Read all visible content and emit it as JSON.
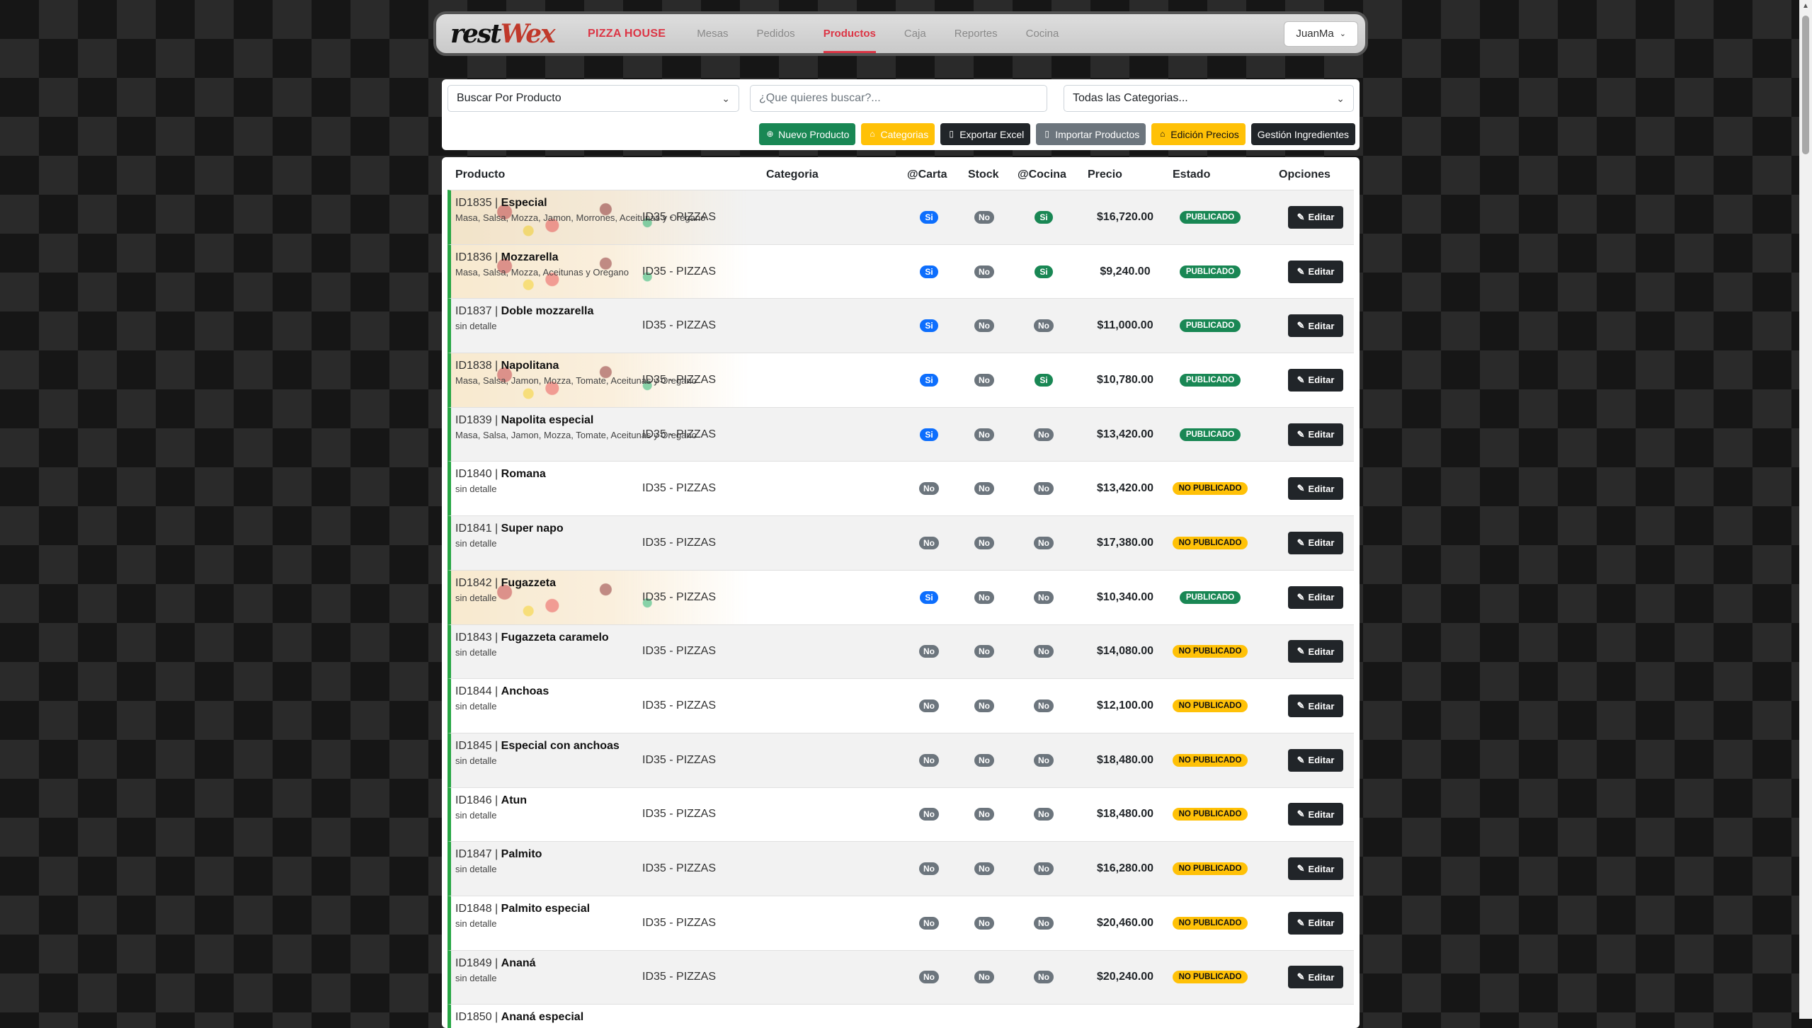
{
  "app": {
    "logo_part1": "rest",
    "logo_part2": "Wex",
    "brand": "PIZZA HOUSE",
    "nav": [
      "Mesas",
      "Pedidos",
      "Productos",
      "Caja",
      "Reportes",
      "Cocina"
    ],
    "active_nav": "Productos",
    "user": "JuanMa"
  },
  "search": {
    "mode_select": "Buscar Por Producto",
    "query_placeholder": "¿Que quieres buscar?...",
    "category_select": "Todas las Categorias..."
  },
  "toolbar": {
    "new_product": "Nuevo Producto",
    "categories": "Categorias",
    "export_excel": "Exportar Excel",
    "import_products": "Importar Productos",
    "edit_prices": "Edición Precios",
    "ingredients": "Gestión Ingredientes"
  },
  "table": {
    "headers": {
      "product": "Producto",
      "category": "Categoria",
      "carta": "@Carta",
      "stock": "Stock",
      "cocina": "@Cocina",
      "price": "Precio",
      "status": "Estado",
      "options": "Opciones"
    },
    "edit_label": "Editar",
    "rows": [
      {
        "id": "ID1835",
        "name": "Especial",
        "desc": "Masa, Salsa, Mozza, Jamon, Morrones, Aceitunas y Oregano",
        "category": "ID35 - PIZZAS",
        "carta": "Si",
        "stock": "No",
        "cocina": "Si",
        "price": "$16,720.00",
        "status": "PUBLICADO",
        "image": true
      },
      {
        "id": "ID1836",
        "name": "Mozzarella",
        "desc": "Masa, Salsa, Mozza, Aceitunas y Oregano",
        "category": "ID35 - PIZZAS",
        "carta": "Si",
        "stock": "No",
        "cocina": "Si",
        "price": "$9,240.00",
        "status": "PUBLICADO",
        "image": true
      },
      {
        "id": "ID1837",
        "name": "Doble mozzarella",
        "desc": "sin detalle",
        "category": "ID35 - PIZZAS",
        "carta": "Si",
        "stock": "No",
        "cocina": "No",
        "price": "$11,000.00",
        "status": "PUBLICADO",
        "image": false
      },
      {
        "id": "ID1838",
        "name": "Napolitana",
        "desc": "Masa, Salsa, Jamon, Mozza, Tomate, Aceitunas y Oregano",
        "category": "ID35 - PIZZAS",
        "carta": "Si",
        "stock": "No",
        "cocina": "Si",
        "price": "$10,780.00",
        "status": "PUBLICADO",
        "image": true
      },
      {
        "id": "ID1839",
        "name": "Napolita especial",
        "desc": "Masa, Salsa, Jamon, Mozza, Tomate, Aceitunas y Oregano",
        "category": "ID35 - PIZZAS",
        "carta": "Si",
        "stock": "No",
        "cocina": "No",
        "price": "$13,420.00",
        "status": "PUBLICADO",
        "image": false
      },
      {
        "id": "ID1840",
        "name": "Romana",
        "desc": "sin detalle",
        "category": "ID35 - PIZZAS",
        "carta": "No",
        "stock": "No",
        "cocina": "No",
        "price": "$13,420.00",
        "status": "NO PUBLICADO",
        "image": false
      },
      {
        "id": "ID1841",
        "name": "Super napo",
        "desc": "sin detalle",
        "category": "ID35 - PIZZAS",
        "carta": "No",
        "stock": "No",
        "cocina": "No",
        "price": "$17,380.00",
        "status": "NO PUBLICADO",
        "image": false
      },
      {
        "id": "ID1842",
        "name": "Fugazzeta",
        "desc": "sin detalle",
        "category": "ID35 - PIZZAS",
        "carta": "Si",
        "stock": "No",
        "cocina": "No",
        "price": "$10,340.00",
        "status": "PUBLICADO",
        "image": true
      },
      {
        "id": "ID1843",
        "name": "Fugazzeta caramelo",
        "desc": "sin detalle",
        "category": "ID35 - PIZZAS",
        "carta": "No",
        "stock": "No",
        "cocina": "No",
        "price": "$14,080.00",
        "status": "NO PUBLICADO",
        "image": false
      },
      {
        "id": "ID1844",
        "name": "Anchoas",
        "desc": "sin detalle",
        "category": "ID35 - PIZZAS",
        "carta": "No",
        "stock": "No",
        "cocina": "No",
        "price": "$12,100.00",
        "status": "NO PUBLICADO",
        "image": false
      },
      {
        "id": "ID1845",
        "name": "Especial con anchoas",
        "desc": "sin detalle",
        "category": "ID35 - PIZZAS",
        "carta": "No",
        "stock": "No",
        "cocina": "No",
        "price": "$18,480.00",
        "status": "NO PUBLICADO",
        "image": false
      },
      {
        "id": "ID1846",
        "name": "Atun",
        "desc": "sin detalle",
        "category": "ID35 - PIZZAS",
        "carta": "No",
        "stock": "No",
        "cocina": "No",
        "price": "$18,480.00",
        "status": "NO PUBLICADO",
        "image": false
      },
      {
        "id": "ID1847",
        "name": "Palmito",
        "desc": "sin detalle",
        "category": "ID35 - PIZZAS",
        "carta": "No",
        "stock": "No",
        "cocina": "No",
        "price": "$16,280.00",
        "status": "NO PUBLICADO",
        "image": false
      },
      {
        "id": "ID1848",
        "name": "Palmito especial",
        "desc": "sin detalle",
        "category": "ID35 - PIZZAS",
        "carta": "No",
        "stock": "No",
        "cocina": "No",
        "price": "$20,460.00",
        "status": "NO PUBLICADO",
        "image": false
      },
      {
        "id": "ID1849",
        "name": "Ananá",
        "desc": "sin detalle",
        "category": "ID35 - PIZZAS",
        "carta": "No",
        "stock": "No",
        "cocina": "No",
        "price": "$20,240.00",
        "status": "NO PUBLICADO",
        "image": false
      },
      {
        "id": "ID1850",
        "name": "Ananá especial",
        "desc": "",
        "category": "",
        "carta": "",
        "stock": "",
        "cocina": "",
        "price": "",
        "status": "",
        "image": false
      }
    ]
  }
}
